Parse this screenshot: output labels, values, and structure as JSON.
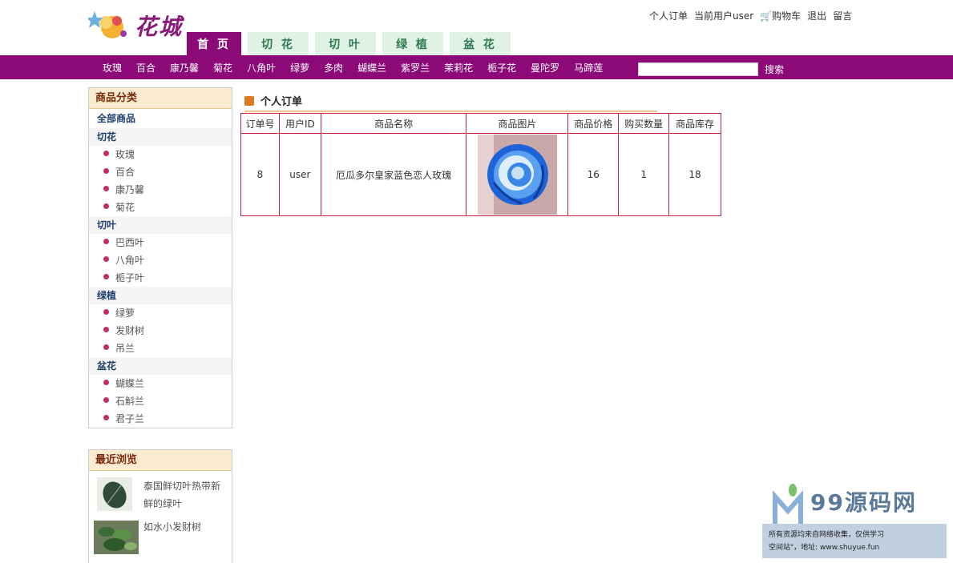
{
  "header": {
    "logo_text": "花城",
    "toplinks": {
      "orders": "个人订单",
      "current_user": "当前用户user",
      "cart": "购物车",
      "logout": "退出",
      "message": "留言"
    },
    "tabs": [
      "首 页",
      "切 花",
      "切 叶",
      "绿 植",
      "盆 花"
    ],
    "active_tab": 0
  },
  "navbar": {
    "items": [
      "玫瑰",
      "百合",
      "康乃馨",
      "菊花",
      "八角叶",
      "绿萝",
      "多肉",
      "蝴蝶兰",
      "紫罗兰",
      "茉莉花",
      "栀子花",
      "曼陀罗",
      "马蹄莲"
    ],
    "search_placeholder": "",
    "search_label": "搜索"
  },
  "sidebar": {
    "category_title": "商品分类",
    "all_label": "全部商品",
    "groups": [
      {
        "name": "切花",
        "items": [
          "玫瑰",
          "百合",
          "康乃馨",
          "菊花"
        ]
      },
      {
        "name": "切叶",
        "items": [
          "巴西叶",
          "八角叶",
          "栀子叶"
        ]
      },
      {
        "name": "绿植",
        "items": [
          "绿萝",
          "发财树",
          "吊兰"
        ]
      },
      {
        "name": "盆花",
        "items": [
          "蝴蝶兰",
          "石斛兰",
          "君子兰"
        ]
      }
    ],
    "recent_title": "最近浏览",
    "recent": [
      "泰国鲜切叶热带新鲜的绿叶",
      "如水小发财树"
    ]
  },
  "main": {
    "title": "个人订单",
    "columns": [
      "订单号",
      "用户ID",
      "商品名称",
      "商品图片",
      "商品价格",
      "购买数量",
      "商品库存"
    ],
    "rows": [
      {
        "order_id": "8",
        "user_id": "user",
        "name": "厄瓜多尔皇家蓝色恋人玫瑰",
        "price": "16",
        "qty": "1",
        "stock": "18"
      }
    ]
  },
  "watermark": {
    "brand": "99源码网",
    "footer_line1": "所有资源均来自网络收集，仅供学习",
    "footer_line2": "空间站\"，地址: www.shuyue.fun"
  }
}
